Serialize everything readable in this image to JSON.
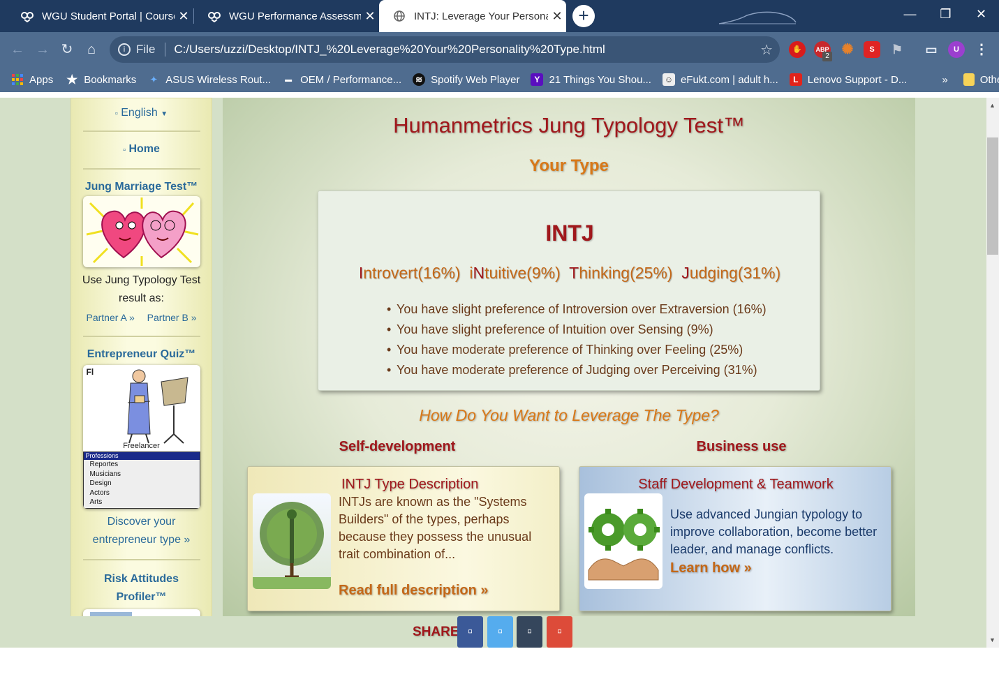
{
  "browser": {
    "tabs": [
      {
        "title": "WGU Student Portal | Courses"
      },
      {
        "title": "WGU Performance Assessment"
      },
      {
        "title": "INTJ: Leverage Your Personality Ty"
      }
    ],
    "new_tab_label": "+",
    "window": {
      "minimize": "—",
      "restore": "❐",
      "close": "✕"
    },
    "address": {
      "scheme_label": "File",
      "url": "C:/Users/uzzi/Desktop/INTJ_%20Leverage%20Your%20Personality%20Type.html"
    },
    "extensions": {
      "abp_badge": "2",
      "abp_label": "ABP",
      "profile_initial": "U",
      "s_label": "S"
    },
    "bookmarks": [
      {
        "label": "Apps",
        "icon": "apps-grid-icon"
      },
      {
        "label": "Bookmarks",
        "icon": "star-icon"
      },
      {
        "label": "ASUS Wireless Rout...",
        "icon": "asus-icon"
      },
      {
        "label": "OEM / Performance...",
        "icon": "oem-icon"
      },
      {
        "label": "Spotify Web Player",
        "icon": "spotify-icon"
      },
      {
        "label": "21 Things You Shou...",
        "icon": "yahoo-icon"
      },
      {
        "label": "eFukt.com | adult h...",
        "icon": "face-icon"
      },
      {
        "label": "Lenovo Support - D...",
        "icon": "lenovo-icon"
      }
    ],
    "bookmarks_overflow": "»",
    "other_bookmarks": "Other bookmarks"
  },
  "sidebar": {
    "language": "English",
    "home": "Home",
    "marriage_title": "Jung Marriage Test™",
    "marriage_desc": "Use Jung Typology Test result as:",
    "partner_a": "Partner A »",
    "partner_b": "Partner B »",
    "entrepreneur_title": "Entrepreneur Quiz™",
    "entrepreneur_img": {
      "fl": "Fl",
      "caption": "Freelancer",
      "list_header": "Professions",
      "list": [
        "Reportes",
        "Musicians",
        "Design",
        "Actors",
        "Arts"
      ]
    },
    "entrepreneur_link": "Discover your entrepreneur type »",
    "risk_title": "Risk Attitudes Profiler™"
  },
  "main": {
    "title": "Humanmetrics Jung Typology Test™",
    "subtitle": "Your Type",
    "type_code": "INTJ",
    "dimensions": [
      {
        "letter": "I",
        "rest": "ntrovert(16%)"
      },
      {
        "prefix": "i",
        "letter": "N",
        "rest": "tuitive(9%)"
      },
      {
        "letter": "T",
        "rest": "hinking(25%)"
      },
      {
        "letter": "J",
        "rest": "udging(31%)"
      }
    ],
    "preferences": [
      "You have slight preference of Introversion over Extraversion (16%)",
      "You have slight preference of Intuition over Sensing (9%)",
      "You have moderate preference of Thinking over Feeling (25%)",
      "You have moderate preference of Judging over Perceiving (31%)"
    ],
    "leverage_question": "How Do You Want to Leverage The Type?",
    "self_dev_heading": "Self-development",
    "business_heading": "Business use",
    "self_card": {
      "title": "INTJ Type Description",
      "text": "INTJs are known as the \"Systems Builders\" of the types, perhaps because they possess the unusual trait combination of...",
      "link": "Read full description »"
    },
    "business_card": {
      "title": "Staff Development & Teamwork",
      "text": "Use advanced Jungian typology to improve collaboration, become better leader, and manage conflicts.",
      "link": "Learn how »"
    }
  },
  "share": {
    "label": "SHARE",
    "buttons": [
      {
        "name": "facebook",
        "color": "#3b5998"
      },
      {
        "name": "twitter",
        "color": "#55acee"
      },
      {
        "name": "tumblr",
        "color": "#35465c"
      },
      {
        "name": "google-plus",
        "color": "#dd4b39"
      }
    ]
  },
  "colors": {
    "accent_red": "#a0181c",
    "accent_orange": "#d87818",
    "link_blue": "#2a6a9a",
    "chrome_dark": "#1f3a5f",
    "chrome_toolbar": "#4f6c8f"
  }
}
